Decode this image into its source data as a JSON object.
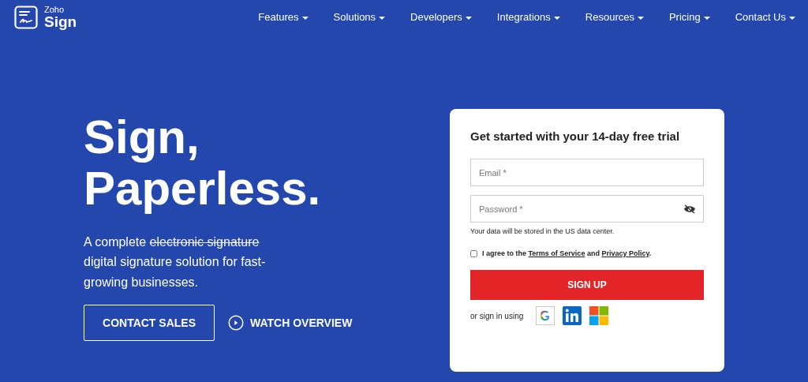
{
  "brand": {
    "line1": "Zoho",
    "line2": "Sign"
  },
  "nav": [
    {
      "label": "Features"
    },
    {
      "label": "Solutions"
    },
    {
      "label": "Developers"
    },
    {
      "label": "Integrations"
    },
    {
      "label": "Resources"
    },
    {
      "label": "Pricing"
    },
    {
      "label": "Contact Us"
    }
  ],
  "hero": {
    "title_lines": [
      "Sign,",
      "Paperless."
    ],
    "description": {
      "before": "A complete",
      "struck": "electronic signature",
      "after": "digital signature solution for fast-growing businesses."
    },
    "contact_button": "CONTACT SALES",
    "watch_link": "WATCH OVERVIEW"
  },
  "form": {
    "title": "Get started with your 14-day free trial",
    "email": {
      "placeholder": "Email *"
    },
    "password": {
      "placeholder": "Password *"
    },
    "data_note": "Your data will be stored in the US data center.",
    "agree": {
      "checked": false,
      "before": "I agree to the",
      "terms": "Terms of Service",
      "middle": "and",
      "privacy": "Privacy Policy",
      "after": "."
    },
    "submit": "SIGN UP",
    "alt_signin": "or sign in using",
    "providers": [
      {
        "kind": "google"
      },
      {
        "kind": "linkedin"
      },
      {
        "kind": "microsoft"
      }
    ]
  }
}
